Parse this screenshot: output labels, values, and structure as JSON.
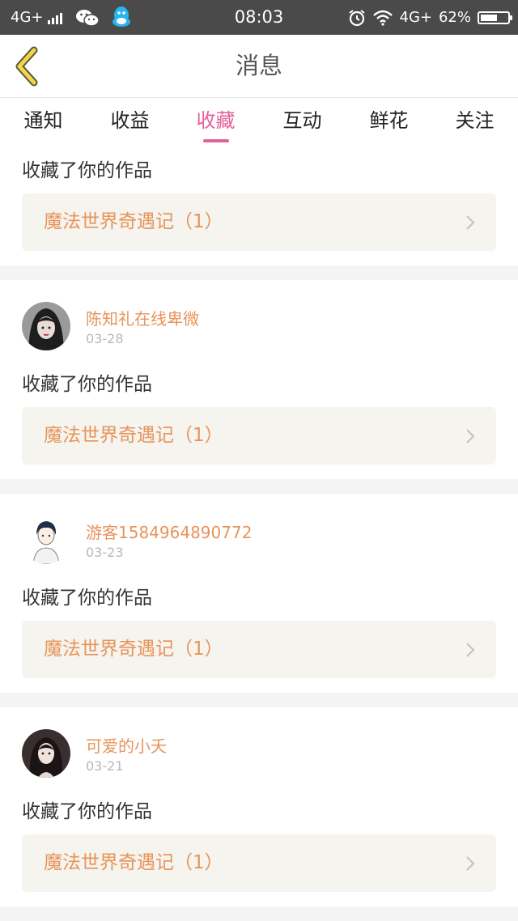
{
  "status_bar": {
    "left_network": "4G+",
    "time": "08:03",
    "right_network": "4G+",
    "battery": "62%",
    "battery_level": 0.62
  },
  "header": {
    "title": "消息"
  },
  "tabs": [
    {
      "label": "通知",
      "active": false
    },
    {
      "label": "收益",
      "active": false
    },
    {
      "label": "收藏",
      "active": true
    },
    {
      "label": "互动",
      "active": false
    },
    {
      "label": "鲜花",
      "active": false
    },
    {
      "label": "关注",
      "active": false
    }
  ],
  "messages": [
    {
      "user": "",
      "date": "",
      "action": "收藏了你的作品",
      "work": "魔法世界奇遇记（1）"
    },
    {
      "user": "陈知礼在线卑微",
      "date": "03-28",
      "action": "收藏了你的作品",
      "work": "魔法世界奇遇记（1）"
    },
    {
      "user": "游客1584964890772",
      "date": "03-23",
      "action": "收藏了你的作品",
      "work": "魔法世界奇遇记（1）"
    },
    {
      "user": "可爱的小夭",
      "date": "03-21",
      "action": "收藏了你的作品",
      "work": "魔法世界奇遇记（1）"
    }
  ],
  "colors": {
    "accent": "#e4609a",
    "work_title": "#e8945a",
    "status_bar": "#4a4a4a",
    "back_arrow": "#f3d44a"
  },
  "icons": [
    "back-arrow-icon",
    "wechat-icon",
    "qq-icon",
    "alarm-icon",
    "wifi-icon",
    "battery-icon",
    "chevron-right-icon"
  ]
}
